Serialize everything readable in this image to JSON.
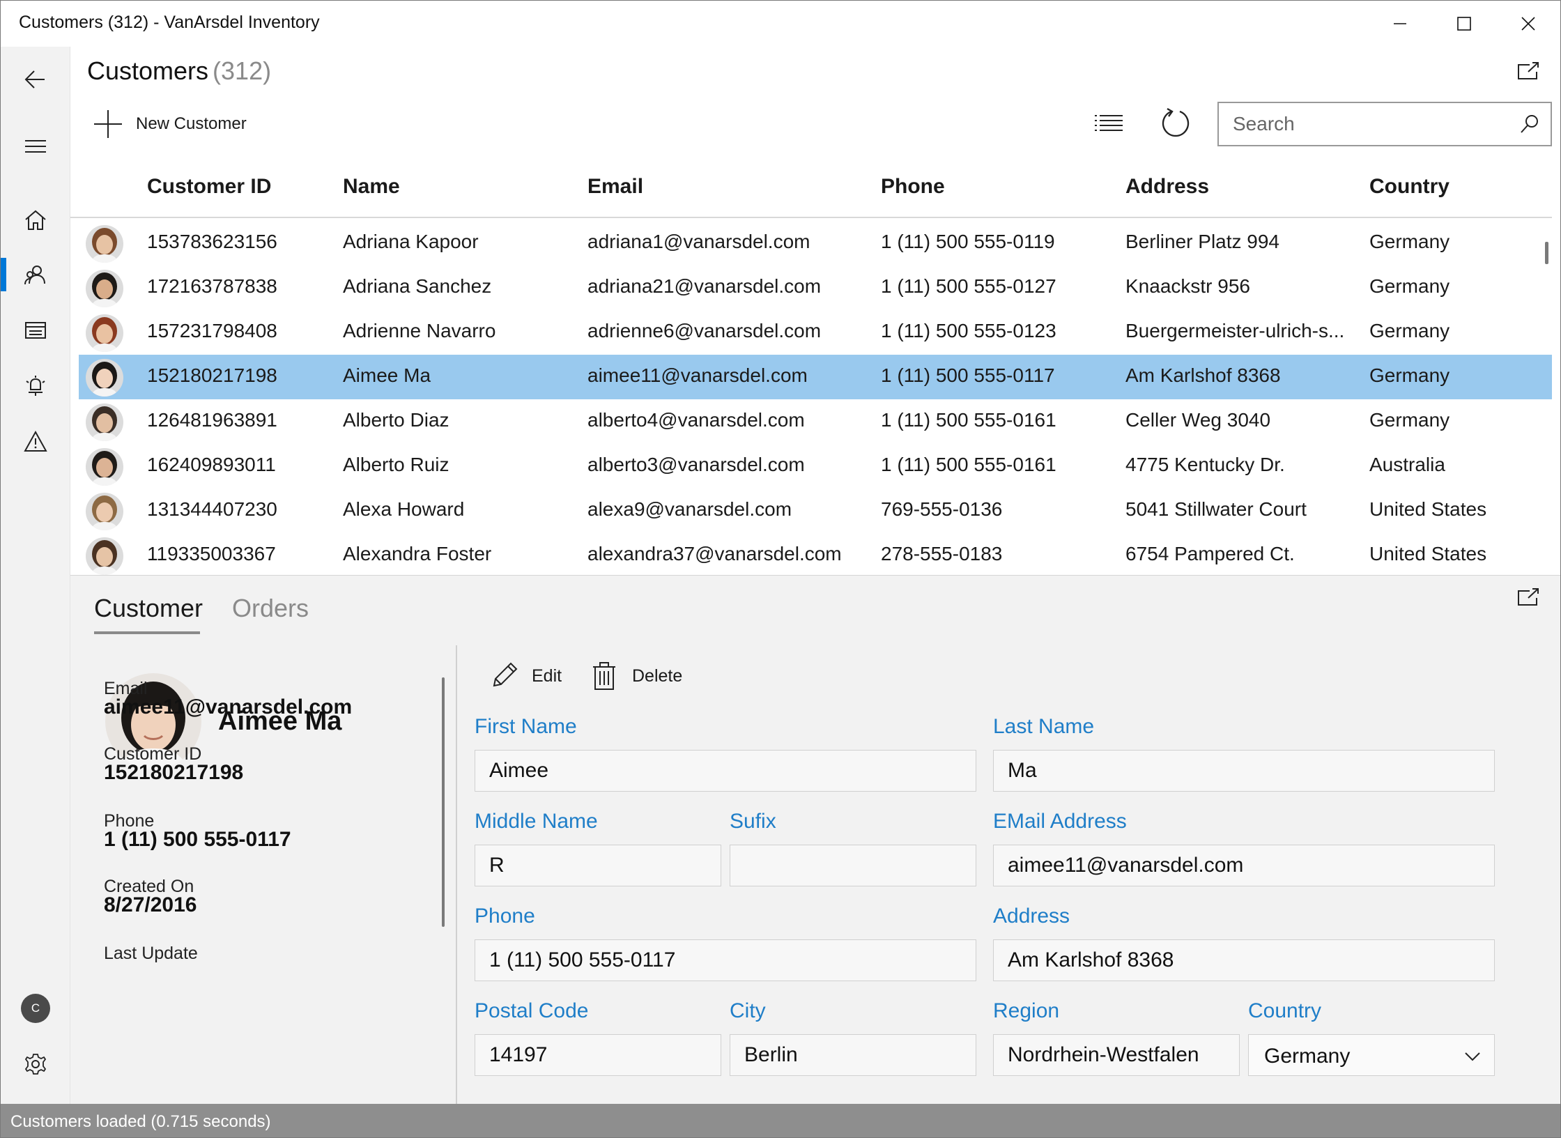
{
  "window": {
    "title": "Customers  (312) - VanArsdel Inventory"
  },
  "nav": {
    "items": [
      {
        "name": "back-icon"
      },
      {
        "name": "hamburger-icon"
      },
      {
        "name": "home-icon"
      },
      {
        "name": "customers-icon"
      },
      {
        "name": "orders-icon"
      },
      {
        "name": "activity-log-icon"
      },
      {
        "name": "warning-icon"
      }
    ],
    "user_initial": "C",
    "accent": "#0078d7"
  },
  "header": {
    "title": "Customers",
    "count": "(312)"
  },
  "toolbar": {
    "new_label": "New Customer",
    "search_placeholder": "Search"
  },
  "grid": {
    "columns": [
      "Customer ID",
      "Name",
      "Email",
      "Phone",
      "Address",
      "Country"
    ],
    "rows": [
      {
        "id": "153783623156",
        "name": "Adriana Kapoor",
        "email": "adriana1@vanarsdel.com",
        "phone": "1 (11) 500 555-0119",
        "address": "Berliner Platz 994",
        "country": "Germany",
        "hair": "#7a4a2c",
        "skin": "#e7c3a4"
      },
      {
        "id": "172163787838",
        "name": "Adriana Sanchez",
        "email": "adriana21@vanarsdel.com",
        "phone": "1 (11) 500 555-0127",
        "address": "Knaackstr 956",
        "country": "Germany",
        "hair": "#1e1a17",
        "skin": "#d9ad8a"
      },
      {
        "id": "157231798408",
        "name": "Adrienne Navarro",
        "email": "adrienne6@vanarsdel.com",
        "phone": "1 (11) 500 555-0123",
        "address": "Buergermeister-ulrich-s...",
        "country": "Germany",
        "hair": "#8a3a20",
        "skin": "#e9c2a2"
      },
      {
        "id": "152180217198",
        "name": "Aimee Ma",
        "email": "aimee11@vanarsdel.com",
        "phone": "1 (11) 500 555-0117",
        "address": "Am Karlshof 8368",
        "country": "Germany",
        "hair": "#1b1816",
        "skin": "#f0d2bc",
        "selected": true
      },
      {
        "id": "126481963891",
        "name": "Alberto Diaz",
        "email": "alberto4@vanarsdel.com",
        "phone": "1 (11) 500 555-0161",
        "address": "Celler Weg 3040",
        "country": "Germany",
        "hair": "#3a2e26",
        "skin": "#e2bfa2"
      },
      {
        "id": "162409893011",
        "name": "Alberto Ruiz",
        "email": "alberto3@vanarsdel.com",
        "phone": "1 (11) 500 555-0161",
        "address": "4775 Kentucky Dr.",
        "country": "Australia",
        "hair": "#1f1b18",
        "skin": "#dcb395"
      },
      {
        "id": "131344407230",
        "name": "Alexa Howard",
        "email": "alexa9@vanarsdel.com",
        "phone": "769-555-0136",
        "address": "5041 Stillwater Court",
        "country": "United States",
        "hair": "#8d6a44",
        "skin": "#eccbb0"
      },
      {
        "id": "119335003367",
        "name": "Alexandra Foster",
        "email": "alexandra37@vanarsdel.com",
        "phone": "278-555-0183",
        "address": "6754 Pampered Ct.",
        "country": "United States",
        "hair": "#4a3222",
        "skin": "#e6c4a6"
      }
    ],
    "selected_color": "#99c9ee"
  },
  "details": {
    "tabs": [
      "Customer",
      "Orders"
    ],
    "profile": {
      "name": "Aimee Ma",
      "email_label": "Email",
      "email": "aimee11@vanarsdel.com",
      "id_label": "Customer ID",
      "id": "152180217198",
      "phone_label": "Phone",
      "phone": "1 (11) 500 555-0117",
      "created_label": "Created On",
      "created": "8/27/2016",
      "updated_label": "Last Update"
    },
    "actions": {
      "edit": "Edit",
      "delete": "Delete"
    },
    "form": {
      "first_name_label": "First Name",
      "first_name": "Aimee",
      "last_name_label": "Last Name",
      "last_name": "Ma",
      "middle_name_label": "Middle Name",
      "middle_name": "R",
      "suffix_label": "Sufix",
      "suffix": "",
      "email_label": "EMail Address",
      "email": "aimee11@vanarsdel.com",
      "phone_label": "Phone",
      "phone": "1 (11) 500 555-0117",
      "address_label": "Address",
      "address": "Am Karlshof 8368",
      "postal_label": "Postal Code",
      "postal": "14197",
      "city_label": "City",
      "city": "Berlin",
      "region_label": "Region",
      "region": "Nordrhein-Westfalen",
      "country_label": "Country",
      "country": "Germany"
    },
    "label_color": "#1f7ec8"
  },
  "status": {
    "text": "Customers loaded (0.715 seconds)"
  }
}
